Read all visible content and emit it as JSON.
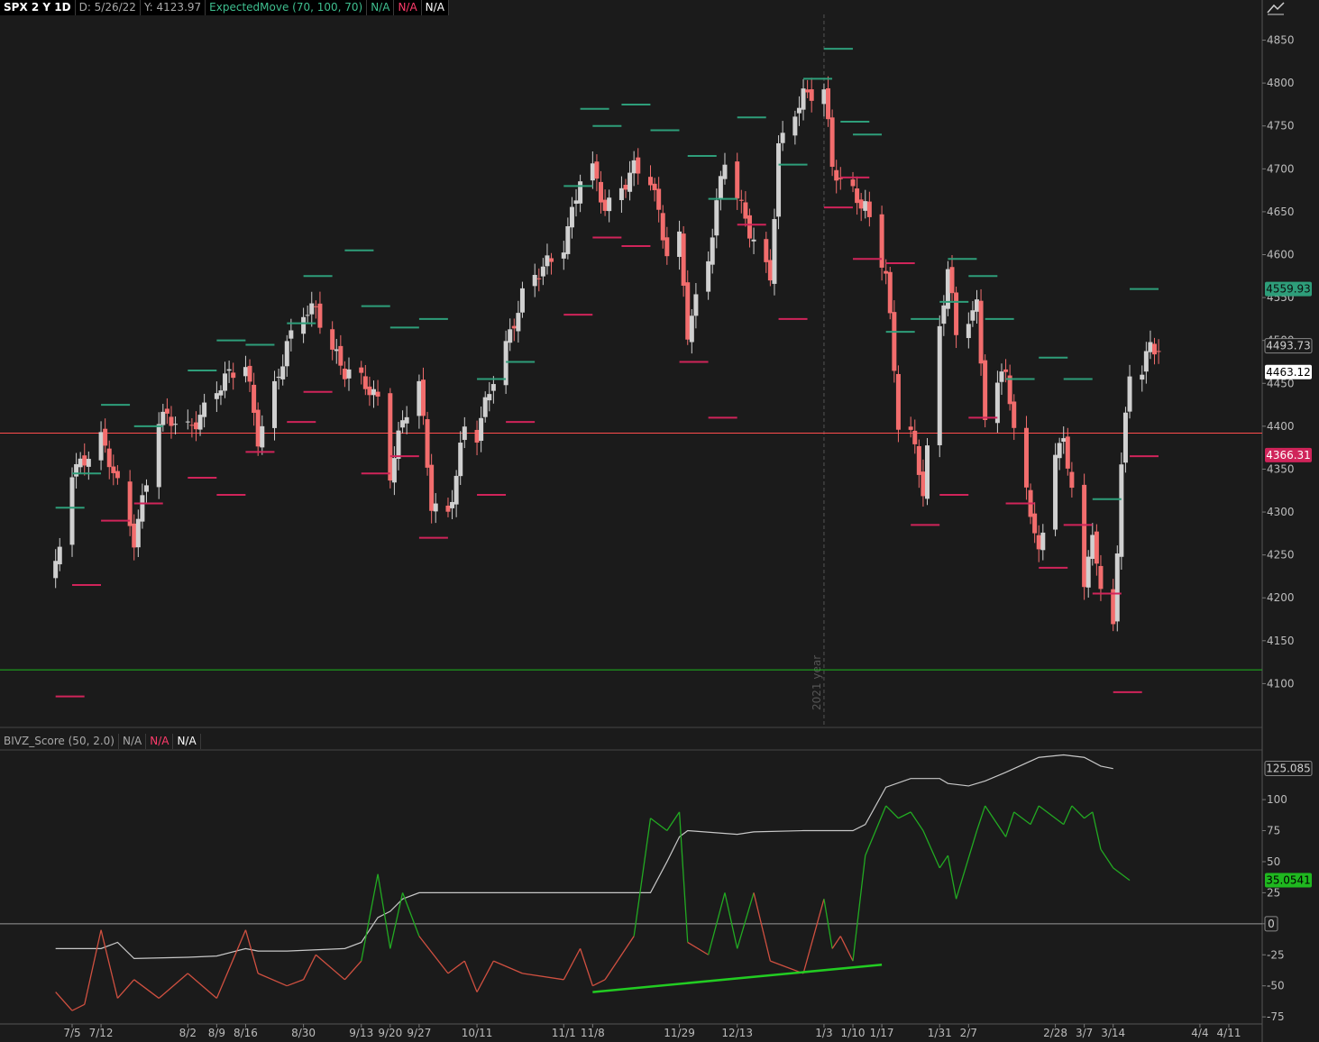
{
  "header": {
    "symbol": "SPX 2 Y 1D",
    "date": "D: 5/26/22",
    "y": "Y: 4123.97",
    "study": "ExpectedMove (70, 100, 70)",
    "na1": "N/A",
    "na2": "N/A",
    "na3": "N/A"
  },
  "lower_header": {
    "study": "BIVZ_Score (50, 2.0)",
    "na1": "N/A",
    "na2": "N/A",
    "na3": "N/A"
  },
  "colors": {
    "background": "#1b1b1b",
    "up": "#d0d0d0",
    "down": "#f26d6d",
    "em_upper": "#2e9e7a",
    "em_lower": "#d0245a",
    "support": "#1fb81f",
    "resistance": "#ff4d4d",
    "score_pos": "#22aa22",
    "score_neg": "#d05040",
    "trendline": "#22cc22"
  },
  "chart_data": [
    {
      "type": "candlestick",
      "title": "SPX 2 Y 1D",
      "ylim": [
        4050,
        4880
      ],
      "y_ticks": [
        4100,
        4150,
        4200,
        4250,
        4300,
        4350,
        4400,
        4450,
        4500,
        4550,
        4600,
        4650,
        4700,
        4750,
        4800,
        4850
      ],
      "price_labels": [
        {
          "value": "4559.93",
          "kind": "green"
        },
        {
          "value": "4493.73",
          "kind": "gray"
        },
        {
          "value": "4463.12",
          "kind": "white"
        },
        {
          "value": "4366.31",
          "kind": "red"
        }
      ],
      "horizontal_lines": [
        {
          "value": 4392,
          "color": "red"
        },
        {
          "value": 4116,
          "color": "green"
        }
      ],
      "vertical_marker": {
        "label": "2021 year",
        "position": "1/3"
      },
      "anchors": [
        [
          "7/1",
          4230
        ],
        [
          "7/5",
          4350
        ],
        [
          "7/12",
          4385
        ],
        [
          "7/20",
          4270
        ],
        [
          "7/26",
          4410
        ],
        [
          "8/2",
          4395
        ],
        [
          "8/9",
          4445
        ],
        [
          "8/16",
          4470
        ],
        [
          "8/19",
          4390
        ],
        [
          "8/26",
          4490
        ],
        [
          "8/30",
          4530
        ],
        [
          "9/2",
          4540
        ],
        [
          "9/9",
          4460
        ],
        [
          "9/13",
          4450
        ],
        [
          "9/17",
          4435
        ],
        [
          "9/20",
          4350
        ],
        [
          "9/23",
          4405
        ],
        [
          "9/27",
          4445
        ],
        [
          "9/30",
          4310
        ],
        [
          "10/4",
          4300
        ],
        [
          "10/8",
          4395
        ],
        [
          "10/11",
          4385
        ],
        [
          "10/15",
          4460
        ],
        [
          "10/22",
          4550
        ],
        [
          "11/1",
          4615
        ],
        [
          "11/5",
          4690
        ],
        [
          "11/8",
          4695
        ],
        [
          "11/11",
          4650
        ],
        [
          "11/18",
          4705
        ],
        [
          "11/22",
          4685
        ],
        [
          "11/26",
          4600
        ],
        [
          "11/29",
          4620
        ],
        [
          "12/1",
          4515
        ],
        [
          "12/6",
          4595
        ],
        [
          "12/10",
          4710
        ],
        [
          "12/13",
          4670
        ],
        [
          "12/17",
          4620
        ],
        [
          "12/21",
          4570
        ],
        [
          "12/23",
          4720
        ],
        [
          "12/29",
          4790
        ],
        [
          "1/3",
          4795
        ],
        [
          "1/5",
          4700
        ],
        [
          "1/7",
          4680
        ],
        [
          "1/10",
          4670
        ],
        [
          "1/13",
          4660
        ],
        [
          "1/18",
          4580
        ],
        [
          "1/21",
          4400
        ],
        [
          "1/24",
          4390
        ],
        [
          "1/27",
          4330
        ],
        [
          "1/31",
          4515
        ],
        [
          "2/2",
          4585
        ],
        [
          "2/4",
          4500
        ],
        [
          "2/9",
          4540
        ],
        [
          "2/11",
          4420
        ],
        [
          "2/16",
          4470
        ],
        [
          "2/18",
          4385
        ],
        [
          "2/22",
          4300
        ],
        [
          "2/24",
          4250
        ],
        [
          "2/28",
          4380
        ],
        [
          "3/2",
          4380
        ],
        [
          "3/4",
          4330
        ],
        [
          "3/7",
          4200
        ],
        [
          "3/9",
          4280
        ],
        [
          "3/11",
          4205
        ],
        [
          "3/14",
          4175
        ],
        [
          "3/16",
          4355
        ],
        [
          "3/18",
          4460
        ],
        [
          "3/21",
          4462
        ],
        [
          "3/23",
          4490
        ],
        [
          "3/25",
          4493
        ]
      ],
      "expected_move_upper": [
        [
          "7/1",
          4305
        ],
        [
          "7/5",
          4345
        ],
        [
          "7/12",
          4425
        ],
        [
          "7/20",
          4400
        ],
        [
          "8/2",
          4465
        ],
        [
          "8/9",
          4500
        ],
        [
          "8/16",
          4495
        ],
        [
          "8/26",
          4520
        ],
        [
          "8/30",
          4575
        ],
        [
          "9/9",
          4605
        ],
        [
          "9/13",
          4540
        ],
        [
          "9/20",
          4515
        ],
        [
          "9/27",
          4525
        ],
        [
          "10/11",
          4455
        ],
        [
          "10/18",
          4475
        ],
        [
          "11/1",
          4680
        ],
        [
          "11/5",
          4770
        ],
        [
          "11/8",
          4750
        ],
        [
          "11/15",
          4775
        ],
        [
          "11/22",
          4745
        ],
        [
          "12/1",
          4715
        ],
        [
          "12/6",
          4665
        ],
        [
          "12/13",
          4760
        ],
        [
          "12/23",
          4705
        ],
        [
          "12/29",
          4805
        ],
        [
          "1/3",
          4840
        ],
        [
          "1/7",
          4755
        ],
        [
          "1/10",
          4740
        ],
        [
          "1/18",
          4510
        ],
        [
          "1/24",
          4525
        ],
        [
          "1/31",
          4545
        ],
        [
          "2/2",
          4595
        ],
        [
          "2/7",
          4575
        ],
        [
          "2/11",
          4525
        ],
        [
          "2/16",
          4455
        ],
        [
          "2/24",
          4480
        ],
        [
          "3/2",
          4455
        ],
        [
          "3/9",
          4315
        ],
        [
          "3/18",
          4560
        ]
      ],
      "expected_move_lower": [
        [
          "7/1",
          4085
        ],
        [
          "7/5",
          4215
        ],
        [
          "7/12",
          4290
        ],
        [
          "7/20",
          4310
        ],
        [
          "8/2",
          4340
        ],
        [
          "8/9",
          4320
        ],
        [
          "8/16",
          4370
        ],
        [
          "8/26",
          4405
        ],
        [
          "8/30",
          4440
        ],
        [
          "9/13",
          4345
        ],
        [
          "9/20",
          4365
        ],
        [
          "9/27",
          4270
        ],
        [
          "10/11",
          4320
        ],
        [
          "10/18",
          4405
        ],
        [
          "11/1",
          4530
        ],
        [
          "11/8",
          4620
        ],
        [
          "11/15",
          4610
        ],
        [
          "11/29",
          4475
        ],
        [
          "12/6",
          4410
        ],
        [
          "12/13",
          4635
        ],
        [
          "12/23",
          4525
        ],
        [
          "1/3",
          4655
        ],
        [
          "1/7",
          4690
        ],
        [
          "1/10",
          4595
        ],
        [
          "1/18",
          4590
        ],
        [
          "1/24",
          4285
        ],
        [
          "1/31",
          4320
        ],
        [
          "2/7",
          4410
        ],
        [
          "2/16",
          4310
        ],
        [
          "2/24",
          4235
        ],
        [
          "3/2",
          4285
        ],
        [
          "3/9",
          4205
        ],
        [
          "3/14",
          4090
        ],
        [
          "3/18",
          4365
        ]
      ]
    },
    {
      "type": "line",
      "title": "BIVZ_Score (50, 2.0)",
      "ylim": [
        -80,
        140
      ],
      "y_ticks": [
        -75,
        -50,
        -25,
        0,
        25,
        50,
        75,
        100
      ],
      "value_labels": [
        {
          "value": "125.085",
          "kind": "gray"
        },
        {
          "value": "35.0541",
          "kind": "green"
        },
        {
          "value": "0",
          "kind": "gray"
        }
      ],
      "series": [
        {
          "role": "score",
          "values": [
            [
              "7/1",
              -55
            ],
            [
              "7/5",
              -70
            ],
            [
              "7/8",
              -65
            ],
            [
              "7/12",
              -5
            ],
            [
              "7/16",
              -60
            ],
            [
              "7/20",
              -45
            ],
            [
              "7/26",
              -60
            ],
            [
              "8/2",
              -40
            ],
            [
              "8/9",
              -60
            ],
            [
              "8/16",
              -5
            ],
            [
              "8/19",
              -40
            ],
            [
              "8/26",
              -50
            ],
            [
              "8/30",
              -45
            ],
            [
              "9/2",
              -25
            ],
            [
              "9/9",
              -45
            ],
            [
              "9/13",
              -30
            ],
            [
              "9/17",
              40
            ],
            [
              "9/20",
              -20
            ],
            [
              "9/23",
              25
            ],
            [
              "9/27",
              -10
            ],
            [
              "10/4",
              -40
            ],
            [
              "10/8",
              -30
            ],
            [
              "10/11",
              -55
            ],
            [
              "10/15",
              -30
            ],
            [
              "10/22",
              -40
            ],
            [
              "11/1",
              -45
            ],
            [
              "11/5",
              -20
            ],
            [
              "11/8",
              -50
            ],
            [
              "11/11",
              -45
            ],
            [
              "11/18",
              -10
            ],
            [
              "11/22",
              85
            ],
            [
              "11/26",
              75
            ],
            [
              "11/29",
              90
            ],
            [
              "12/1",
              -15
            ],
            [
              "12/6",
              -25
            ],
            [
              "12/10",
              25
            ],
            [
              "12/13",
              -20
            ],
            [
              "12/17",
              25
            ],
            [
              "12/21",
              -30
            ],
            [
              "12/29",
              -40
            ],
            [
              "1/3",
              20
            ],
            [
              "1/5",
              -20
            ],
            [
              "1/7",
              -10
            ],
            [
              "1/10",
              -30
            ],
            [
              "1/13",
              55
            ],
            [
              "1/18",
              95
            ],
            [
              "1/21",
              85
            ],
            [
              "1/24",
              90
            ],
            [
              "1/27",
              75
            ],
            [
              "1/31",
              45
            ],
            [
              "2/2",
              55
            ],
            [
              "2/4",
              20
            ],
            [
              "2/9",
              75
            ],
            [
              "2/11",
              95
            ],
            [
              "2/16",
              70
            ],
            [
              "2/18",
              90
            ],
            [
              "2/22",
              80
            ],
            [
              "2/24",
              95
            ],
            [
              "3/2",
              80
            ],
            [
              "3/4",
              95
            ],
            [
              "3/7",
              85
            ],
            [
              "3/9",
              90
            ],
            [
              "3/11",
              60
            ],
            [
              "3/14",
              45
            ],
            [
              "3/18",
              35
            ]
          ]
        },
        {
          "role": "band",
          "values": [
            [
              "7/1",
              -20
            ],
            [
              "7/12",
              -20
            ],
            [
              "7/16",
              -15
            ],
            [
              "7/20",
              -28
            ],
            [
              "8/2",
              -27
            ],
            [
              "8/9",
              -26
            ],
            [
              "8/16",
              -20
            ],
            [
              "8/19",
              -22
            ],
            [
              "8/26",
              -22
            ],
            [
              "9/9",
              -20
            ],
            [
              "9/13",
              -15
            ],
            [
              "9/17",
              5
            ],
            [
              "9/20",
              10
            ],
            [
              "9/23",
              20
            ],
            [
              "9/27",
              25
            ],
            [
              "10/4",
              25
            ],
            [
              "11/1",
              25
            ],
            [
              "11/22",
              25
            ],
            [
              "11/26",
              50
            ],
            [
              "11/29",
              70
            ],
            [
              "12/1",
              75
            ],
            [
              "12/13",
              72
            ],
            [
              "12/17",
              74
            ],
            [
              "12/29",
              75
            ],
            [
              "1/10",
              75
            ],
            [
              "1/13",
              80
            ],
            [
              "1/18",
              110
            ],
            [
              "1/24",
              117
            ],
            [
              "1/31",
              117
            ],
            [
              "2/2",
              113
            ],
            [
              "2/7",
              111
            ],
            [
              "2/11",
              115
            ],
            [
              "2/16",
              122
            ],
            [
              "2/24",
              134
            ],
            [
              "3/2",
              136
            ],
            [
              "3/7",
              134
            ],
            [
              "3/11",
              127
            ],
            [
              "3/14",
              125
            ]
          ]
        }
      ],
      "annotations": [
        {
          "kind": "trendline",
          "from": [
            "11/8",
            -55
          ],
          "to": [
            "1/17",
            -33
          ]
        }
      ]
    }
  ],
  "x_axis": {
    "ticks": [
      "7/5",
      "7/12",
      "8/2",
      "8/9",
      "8/16",
      "8/30",
      "9/13",
      "9/20",
      "9/27",
      "10/11",
      "11/1",
      "11/8",
      "11/29",
      "12/13",
      "1/3",
      "1/10",
      "1/17",
      "1/31",
      "2/7",
      "2/28",
      "3/7",
      "3/14",
      "4/4",
      "4/11"
    ]
  }
}
